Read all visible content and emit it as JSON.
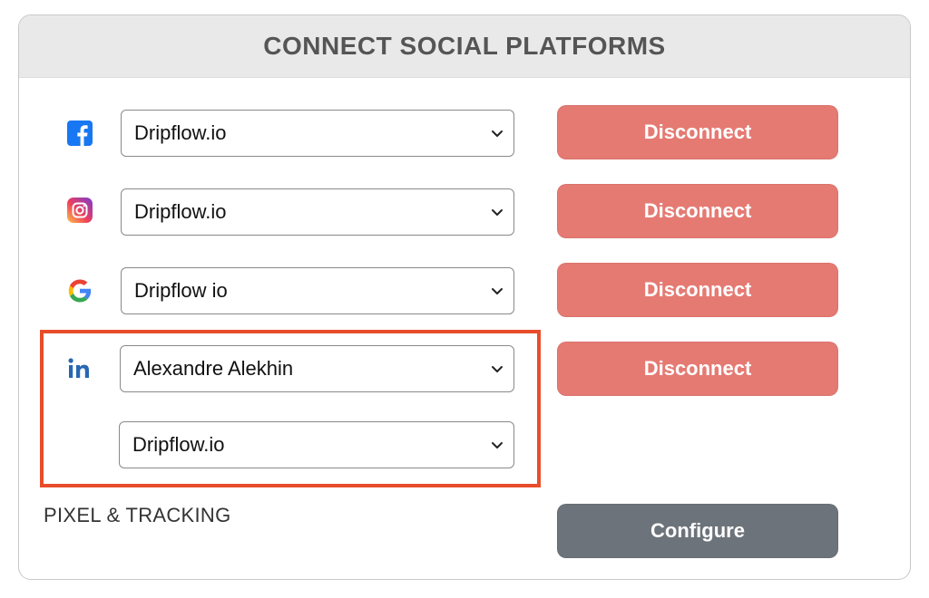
{
  "header": {
    "title": "CONNECT SOCIAL PLATFORMS"
  },
  "platforms": [
    {
      "icon": "facebook-icon",
      "selected": "Dripflow.io",
      "action": "Disconnect"
    },
    {
      "icon": "instagram-icon",
      "selected": "Dripflow.io",
      "action": "Disconnect"
    },
    {
      "icon": "google-icon",
      "selected": "Dripflow io",
      "action": "Disconnect"
    },
    {
      "icon": "linkedin-icon",
      "selected": "Alexandre Alekhin",
      "secondary_selected": "Dripflow.io",
      "action": "Disconnect"
    }
  ],
  "pixel_tracking": {
    "label": "PIXEL & TRACKING",
    "action": "Configure"
  },
  "colors": {
    "disconnect": "#e57a73",
    "configure": "#6d737a",
    "highlight": "#e84d2b",
    "header_bg": "#e9e9e9"
  }
}
